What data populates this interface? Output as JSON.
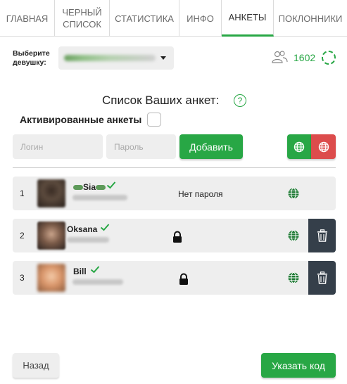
{
  "tabs": [
    {
      "label": "ГЛАВНАЯ"
    },
    {
      "label": "ЧЕРНЫЙ\nСПИСОК"
    },
    {
      "label": "СТАТИСТИКА"
    },
    {
      "label": "ИНФО"
    },
    {
      "label": "АНКЕТЫ",
      "active": true
    },
    {
      "label": "ПОКЛОННИКИ"
    }
  ],
  "selector": {
    "label": "Выберите девушку:",
    "count": "1602"
  },
  "section": {
    "title": "Список Ваших анкет:",
    "help_icon": "question-circle-icon",
    "activated_label": "Активированные анкеты"
  },
  "form": {
    "login_placeholder": "Логин",
    "password_placeholder": "Пароль",
    "add_label": "Добавить"
  },
  "rows": [
    {
      "num": "1",
      "name": "Sia",
      "status": "Нет пароля"
    },
    {
      "num": "2",
      "name": "Oksana"
    },
    {
      "num": "3",
      "name": "Bill"
    }
  ],
  "footer": {
    "back_label": "Назад",
    "code_label": "Указать код"
  },
  "colors": {
    "accent": "#28a745",
    "danger": "#dc4c4c",
    "dark": "#353f4a"
  }
}
